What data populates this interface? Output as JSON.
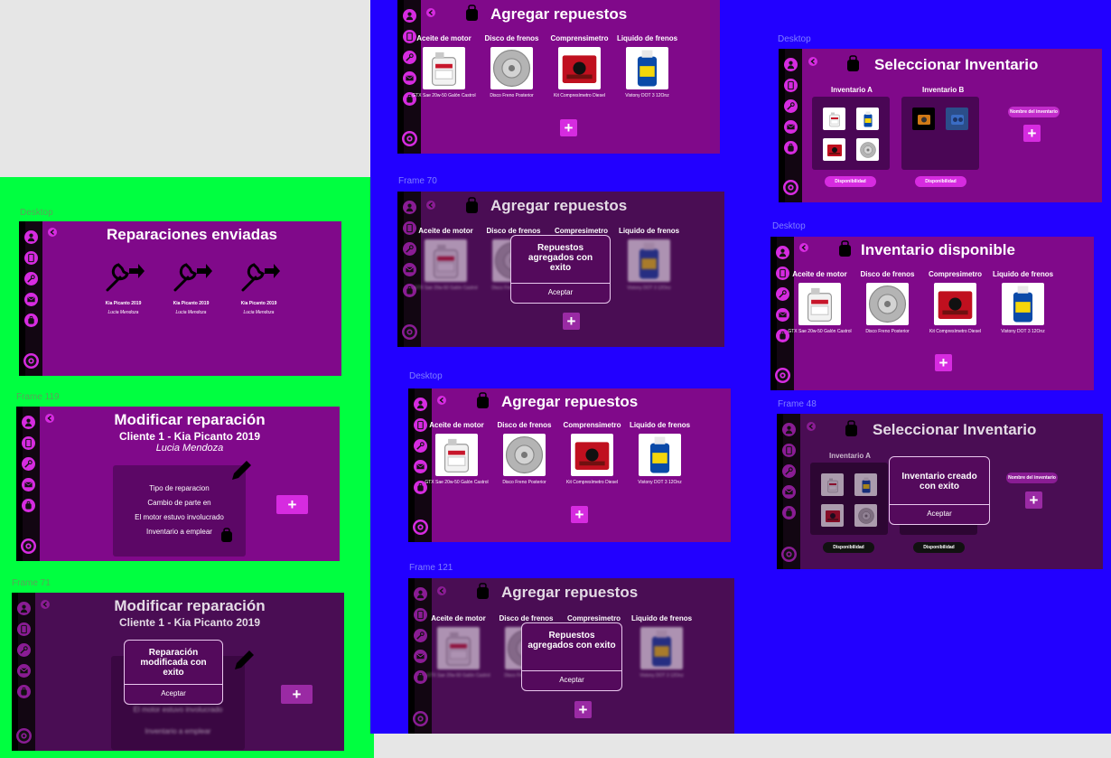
{
  "canvas": {
    "colors": {
      "gray": "#e6e6e6",
      "green": "#00ff40",
      "blue": "#2200ff",
      "purple": "#80098a",
      "purple_dim": "#4a0d54",
      "pink": "#d62be0",
      "sidebar": "#120612"
    }
  },
  "labels": {
    "desktop": "Desktop",
    "frame70": "Frame 70",
    "frame119": "Frame 119",
    "frame71": "Frame 71",
    "frame121": "Frame 121",
    "frame48": "Frame 48"
  },
  "sidebar_icons": [
    "user-icon",
    "document-icon",
    "wrench-icon",
    "mail-icon",
    "backpack-icon",
    "settings-gear-icon"
  ],
  "common": {
    "add_parts_title": "Agregar repuestos",
    "plus": "+",
    "parts": [
      {
        "name": "Aceite de motor",
        "caption": "GTX Sae 20w-50 Galón Castrol",
        "icon": "oil-bottle-icon"
      },
      {
        "name": "Disco de frenos",
        "caption": "Disco Freno Posterior",
        "icon": "brake-disc-icon"
      },
      {
        "name": "Comprensimetro",
        "caption": "Kit Compresímetro Diesel",
        "icon": "compression-kit-icon"
      },
      {
        "name": "Liquido de frenos",
        "caption": "Vistony DOT 3 12Onz",
        "icon": "brake-fluid-icon"
      }
    ],
    "parts_alt": [
      {
        "name": "Aceite de motor",
        "caption": "GTX Sae 20w-50 Galón Castrol",
        "icon": "oil-bottle-icon"
      },
      {
        "name": "Disco de frenos",
        "caption": "Disco Freno Posterior",
        "icon": "brake-disc-icon"
      },
      {
        "name": "Compresimetro",
        "caption": "Kit Compresímetro Diesel",
        "icon": "compression-kit-icon"
      },
      {
        "name": "Liquido de frenos",
        "caption": "Vistony DOT 3 12Onz",
        "icon": "brake-fluid-icon"
      }
    ],
    "modal_parts_added": "Repuestos agregados con exito",
    "accept": "Aceptar"
  },
  "frame_repairs_sent": {
    "title": "Reparaciones enviadas",
    "items": [
      {
        "car": "Kia Picanto 2019",
        "client": "Lucia Mendoza"
      },
      {
        "car": "Kia Picanto 2019",
        "client": "Lucia Mendoza"
      },
      {
        "car": "Kia Picanto 2019",
        "client": "Lucia Mendoza"
      }
    ]
  },
  "frame_modify": {
    "title": "Modificar reparación",
    "subtitle": "Cliente 1 -  Kia Picanto 2019",
    "client": "Lucia Mendoza",
    "lines": [
      "Tipo de reparacion",
      "Cambio de parte en",
      "El motor estuvo involucrado",
      "Inventario a emplear"
    ],
    "modal": "Reparación modificada con exito"
  },
  "frame_select_inventory": {
    "title": "Seleccionar Inventario",
    "inv_a": "Inventario A",
    "inv_b": "Inventario B",
    "availability": "Disponibilidad",
    "name_field": "Nombre del inventario",
    "modal": "Inventario creado con exito"
  },
  "frame_available": {
    "title": "Inventario disponible"
  }
}
